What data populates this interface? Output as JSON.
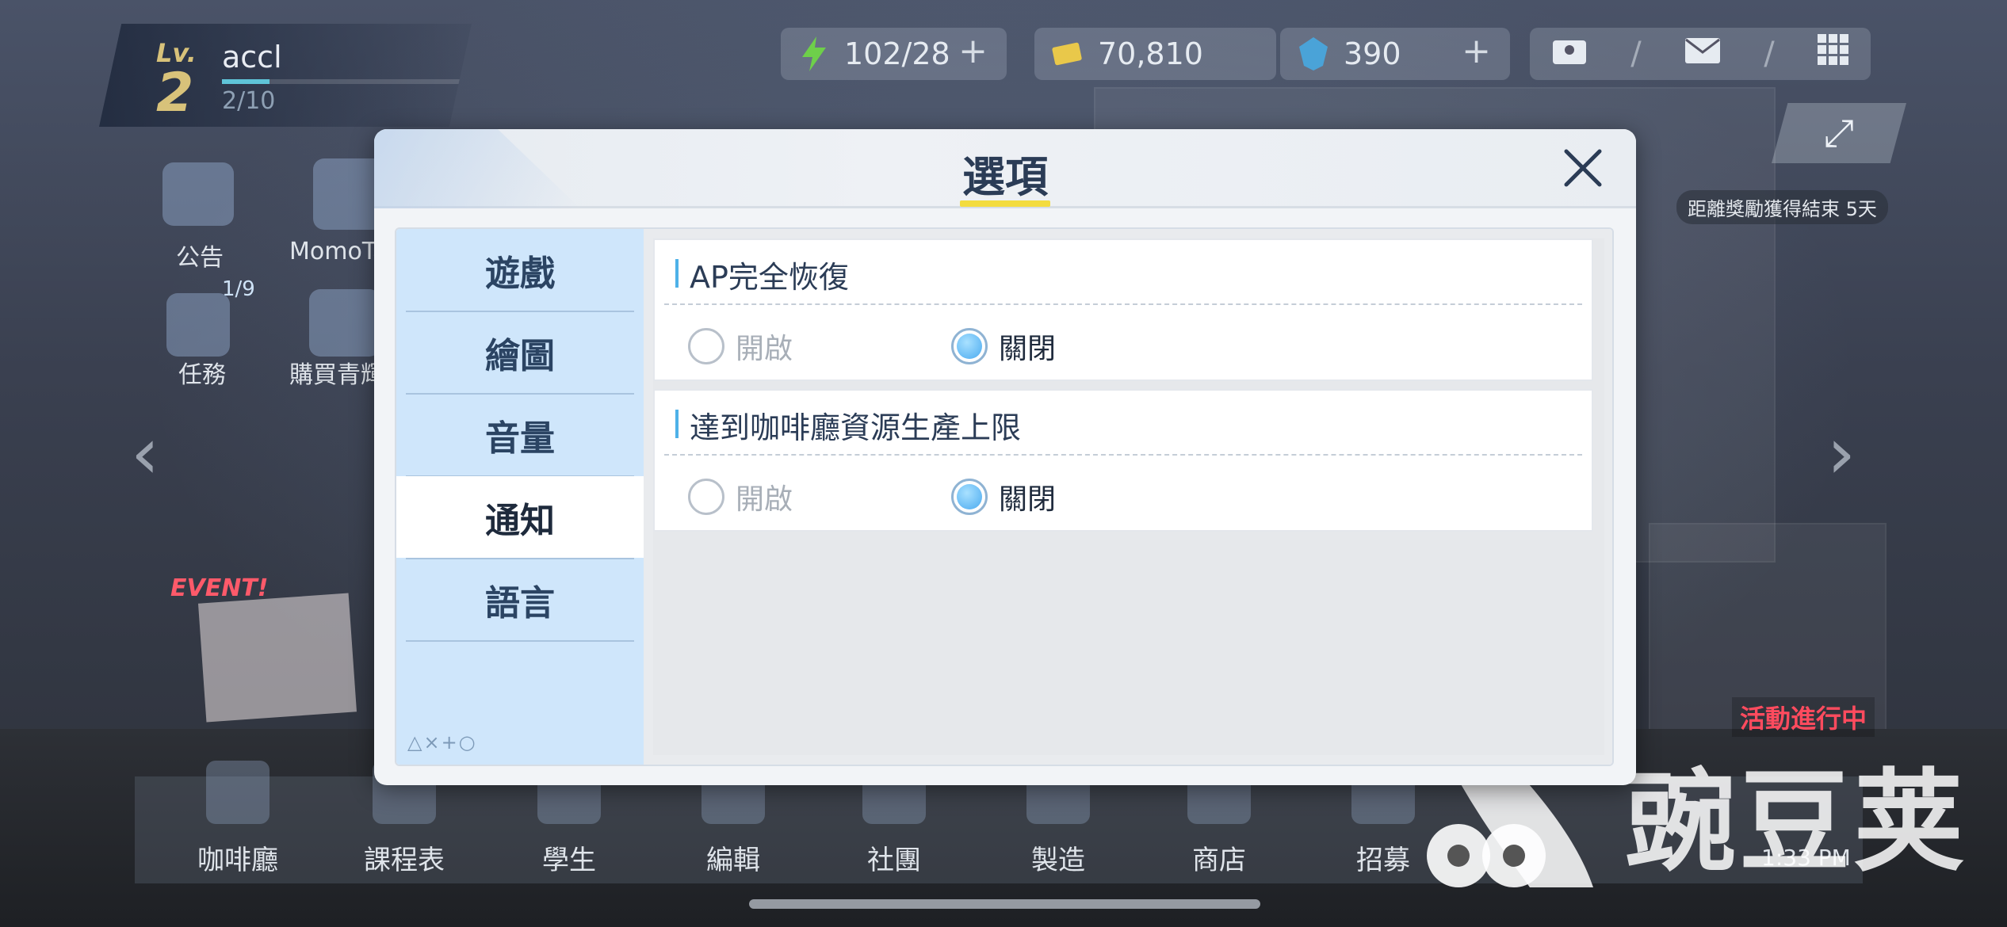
{
  "player": {
    "level_label": "Lv.",
    "level": "2",
    "name": "accl",
    "exp": "2/10",
    "exp_progress": 0.2
  },
  "resources": {
    "ap": "102/28",
    "credits": "70,810",
    "gems": "390"
  },
  "left_menu": {
    "notice": "公告",
    "momotalk": "MomoTa",
    "missions": "任務",
    "mission_count": "1/9",
    "purchase": "購買青輝"
  },
  "reward_banner": "距離獎勵獲得結束 5天",
  "event_badge": "EVENT!",
  "event_right": "活動進行中",
  "bottom_menu": [
    "咖啡廳",
    "課程表",
    "學生",
    "編輯",
    "社團",
    "製造",
    "商店",
    "招募"
  ],
  "clock": "1:33 PM",
  "watermark": "豌豆荚",
  "dialog": {
    "title": "選項",
    "tabs": [
      "遊戲",
      "繪圖",
      "音量",
      "通知",
      "語言"
    ],
    "active_tab": "通知",
    "shapes": "△×+○",
    "options": [
      {
        "title": "AP完全恢復",
        "on_label": "開啟",
        "off_label": "關閉",
        "selected": "關閉"
      },
      {
        "title": "達到咖啡廳資源生產上限",
        "on_label": "開啟",
        "off_label": "關閉",
        "selected": "關閉"
      }
    ]
  },
  "colors": {
    "accent_yellow": "#f3dc3f",
    "tab_bg": "#cfe6fb",
    "radio_selected": "#4aaaf0",
    "title_text": "#2b3c56"
  }
}
